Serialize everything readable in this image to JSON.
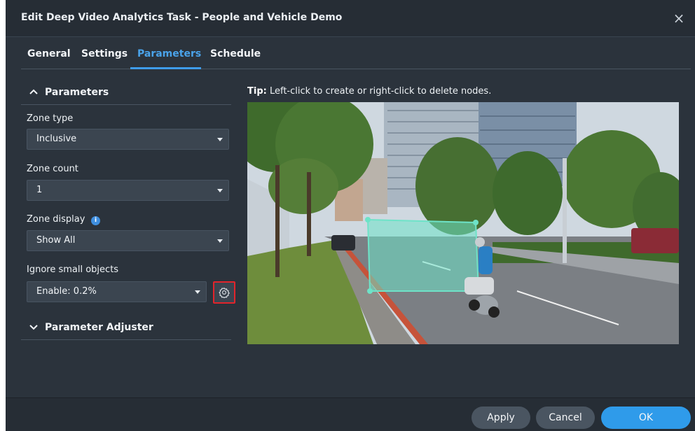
{
  "window": {
    "title": "Edit Deep Video Analytics Task - People and Vehicle Demo",
    "close_label": "×"
  },
  "tabs": [
    {
      "label": "General"
    },
    {
      "label": "Settings"
    },
    {
      "label": "Parameters",
      "active": true
    },
    {
      "label": "Schedule"
    }
  ],
  "parameters": {
    "section_label": "Parameters",
    "zone_type": {
      "label": "Zone type",
      "value": "Inclusive"
    },
    "zone_count": {
      "label": "Zone count",
      "value": "1"
    },
    "zone_display": {
      "label": "Zone display",
      "value": "Show All",
      "info_icon": "i"
    },
    "ignore_small": {
      "label": "Ignore small objects",
      "value": "Enable: 0.2%"
    }
  },
  "adjuster": {
    "section_label": "Parameter Adjuster"
  },
  "tip": {
    "prefix": "Tip:",
    "text": " Left-click to create or right-click to delete nodes."
  },
  "zone_polygon_color": "#6ee3c8",
  "footer": {
    "apply": "Apply",
    "cancel": "Cancel",
    "ok": "OK"
  },
  "colors": {
    "accent": "#3f9cea",
    "dialog_bg": "#2b333c",
    "highlight": "#e2242b"
  }
}
